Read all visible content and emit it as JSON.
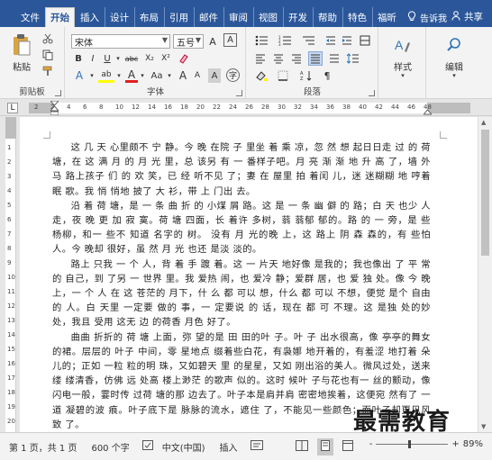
{
  "tabs": [
    {
      "label": "文件",
      "active": false
    },
    {
      "label": "开始",
      "active": true
    },
    {
      "label": "插入",
      "active": false
    },
    {
      "label": "设计",
      "active": false
    },
    {
      "label": "布局",
      "active": false
    },
    {
      "label": "引用",
      "active": false
    },
    {
      "label": "邮件",
      "active": false
    },
    {
      "label": "审阅",
      "active": false
    },
    {
      "label": "视图",
      "active": false
    },
    {
      "label": "开发",
      "active": false
    },
    {
      "label": "帮助",
      "active": false
    },
    {
      "label": "特色",
      "active": false
    },
    {
      "label": "福昕",
      "active": false
    }
  ],
  "tellme": "告诉我",
  "share": "共享",
  "ribbon": {
    "paste_label": "粘贴",
    "clipboard_label": "剪贴板",
    "font_name": "宋体",
    "font_size": "五号",
    "font_label": "字体",
    "paragraph_label": "段落",
    "styles_label": "样式",
    "edit_label": "编辑",
    "grow": "A",
    "shrink": "A",
    "aa": "Aa",
    "clear": "A",
    "bold": "B",
    "italic": "I",
    "underline": "U",
    "strike": "abc",
    "sub": "X₂",
    "sup": "X²",
    "text_effect": "A",
    "highlight": "ab",
    "font_color": "A",
    "phonetic": "文",
    "border_char": "A",
    "grow2": "A",
    "shrink2": "A",
    "char_shade": "A",
    "circle_char": "字"
  },
  "ruler_numbers": [
    "2",
    "2",
    "4",
    "6",
    "8",
    "10",
    "12",
    "14",
    "16",
    "18",
    "20",
    "22",
    "24",
    "26",
    "28",
    "30",
    "32",
    "34",
    "36",
    "38",
    "40",
    "42",
    "44",
    "46",
    "48"
  ],
  "vruler_numbers": [
    "1",
    "2",
    "3",
    "4",
    "5",
    "6",
    "7",
    "8",
    "9",
    "10",
    "11",
    "12",
    "13",
    "14",
    "15",
    "16",
    "17",
    "18",
    "19",
    "20"
  ],
  "document": {
    "paragraphs": [
      "这 几 天 心里颇不 宁 静。今 晚 在院 子 里坐 着 乘 凉，忽 然 想 起日日走 过 的 荷 塘，在 这 满 月 的 月 光 里，总 该另 有 一 番样子吧。月 亮 渐 渐 地 升 高 了，墙 外马 路上孩子 们 的 欢 笑，已 经 听不见 了；妻 在 屋里 拍 着闰 儿，迷 迷糊糊 地 哼着 眠 歌。我 悄 悄地 披了 大 衫，带 上 门出 去。",
      "沿 着 荷 塘，是 一 条 曲 折 的 小煤 屑 路。这 是 一 条 幽 僻 的 路；白 天 也少 人 走，夜 晚 更 加 寂 寞。荷 塘 四面，长 着许 多树，蓊 蓊郁 郁的。路 的 一 旁，是 些 杨柳，和一 些不 知道 名字的 树。 没有 月 光的晚 上，这 路上 阴 森 森的，有 些怕 人。今 晚却 很好，虽 然 月 光 也还 是淡 淡的。",
      "路上 只我 一 个 人，背 着 手 踱 着。这 一 片天 地好像 是我的；我也像出 了 平 常的 自己，到 了另 一 世界 里。我 爱热 闹，也 爱冷 静；爱群 居，也 爱 独 处。像 今 晚 上，一 个 人 在 这 苍茫的 月下，什 么 都 可以 想，什么 都 可以 不想，便觉 是个 自由的 人。白 天里 一定要 做的 事，一 定要说 的 话，现在 都 可 不理。这 是独 处的妙 处，我且 受用 这无 边 的荷香 月色 好了。",
      "曲曲 折折的 荷 塘 上面，弥 望的是 田 田的叶 子。叶 子 出水很高，像 亭亭的舞女 的裙。层层的 叶子 中间，零 星地点 缀着些白花，有袅娜 地开着的，有羞涩 地打着 朵儿的；正如 一粒 粒的明 珠，又如碧天 里 的星星，又如 刚出浴的美人。微风过处，送来缕 缕清香，仿佛 远 处高 楼上渺茫 的歌声 似的。这时 候叶 子与花也有一 丝的颤动，像闪电一般，霎时传 过荷 塘的那 边去了。叶子本是肩并肩 密密地挨着，这便宛 然有了 一道 凝碧的波 痕。叶子底下是 脉脉的流水，遮住 了，不能见一些颜色；而叶子却更见风致 了。"
    ]
  },
  "status": {
    "page": "第 1 页，共 1 页",
    "words": "600 个字",
    "lang": "中文(中国)",
    "mode": "插入",
    "zoom": "89%",
    "zoom_minus": "-",
    "zoom_plus": "+"
  },
  "watermark": "最需教育"
}
